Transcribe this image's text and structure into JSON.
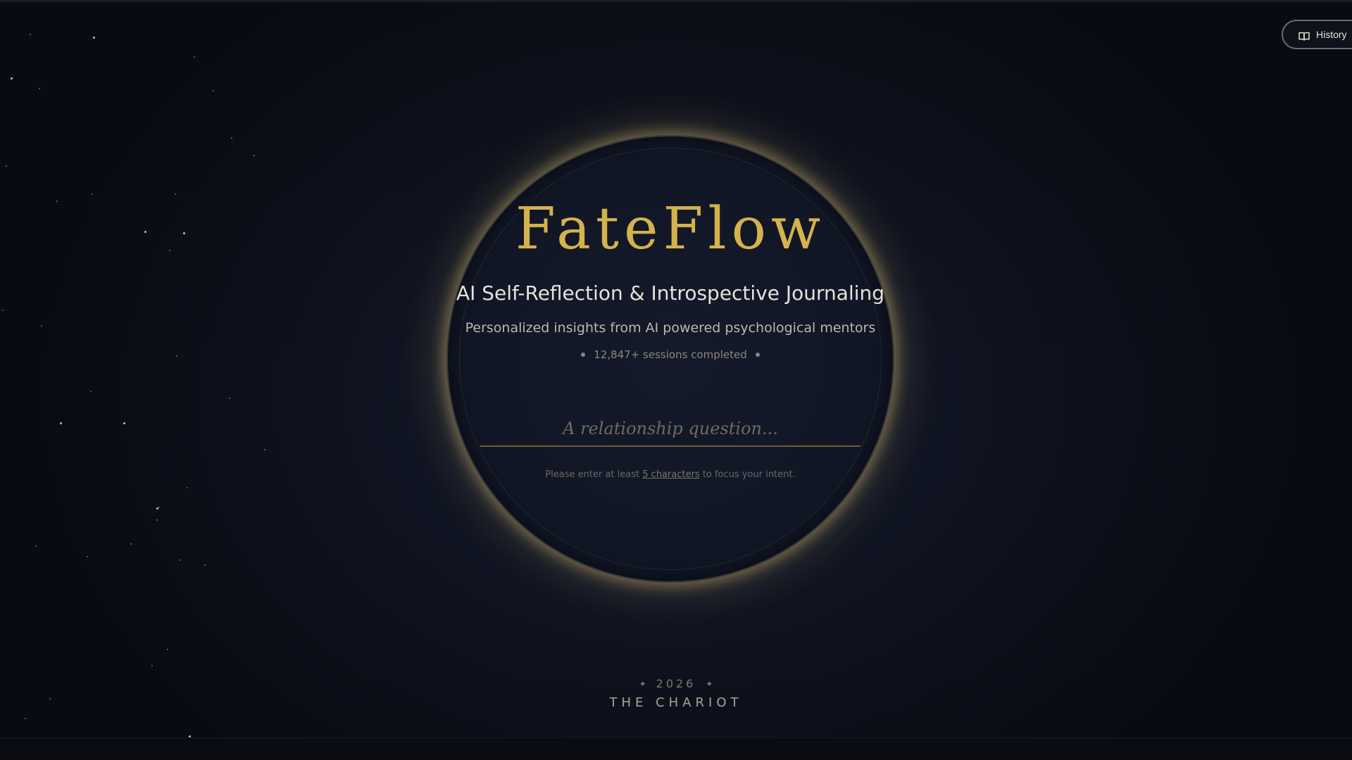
{
  "header": {
    "history_label": "History",
    "history_icon": "book-icon"
  },
  "hero": {
    "logo": "FateFlow",
    "subtitle": "AI Self-Reflection & Introspective Journaling",
    "tagline": "Personalized insights from AI powered psychological mentors",
    "sessions": "12,847+ sessions completed"
  },
  "question": {
    "value": "",
    "placeholder": "A relationship question..."
  },
  "hint": {
    "before": "Please enter at least ",
    "emph": "5 characters",
    "after": " to focus your intent."
  },
  "footer": {
    "year": "2026",
    "card": "THE CHARIOT"
  },
  "colors": {
    "gold": "#d4b24c",
    "background": "#0c0f18",
    "glow": "#e1c878"
  }
}
